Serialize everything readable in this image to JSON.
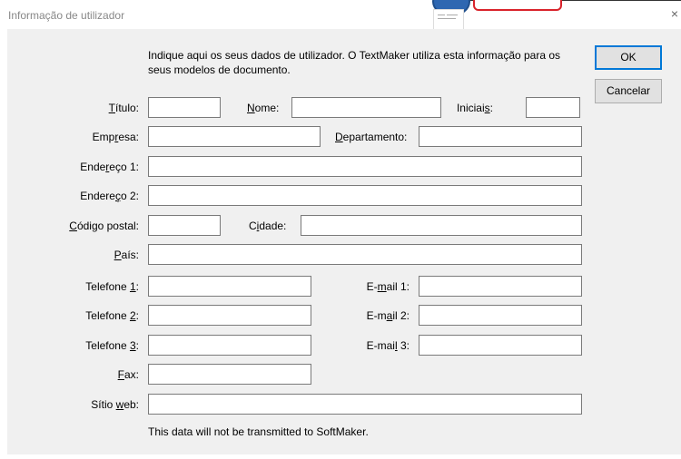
{
  "window": {
    "title": "Informação de utilizador",
    "close_glyph": "×"
  },
  "intro_text": "Indique aqui os seus dados de utilizador. O TextMaker utiliza esta informação para os seus modelos de documento.",
  "buttons": {
    "ok": "OK",
    "cancel": "Cancelar"
  },
  "labels": {
    "titulo": {
      "pre": "",
      "u": "T",
      "post": "ítulo:"
    },
    "nome": {
      "pre": "",
      "u": "N",
      "post": "ome:"
    },
    "iniciais": {
      "pre": "Iniciai",
      "u": "s",
      "post": ":"
    },
    "empresa": {
      "pre": "Emp",
      "u": "r",
      "post": "esa:"
    },
    "departamento": {
      "pre": "",
      "u": "D",
      "post": "epartamento:"
    },
    "endereco1": {
      "pre": "Ende",
      "u": "r",
      "post": "eço 1:"
    },
    "endereco2": {
      "pre": "Endere",
      "u": "ç",
      "post": "o 2:"
    },
    "codigo_postal": {
      "pre": "",
      "u": "C",
      "post": "ódigo postal:"
    },
    "cidade": {
      "pre": "C",
      "u": "i",
      "post": "dade:"
    },
    "pais": {
      "pre": "",
      "u": "P",
      "post": "aís:"
    },
    "telefone1": {
      "pre": "Telefone ",
      "u": "1",
      "post": ":"
    },
    "email1": {
      "pre": "E-",
      "u": "m",
      "post": "ail 1:"
    },
    "telefone2": {
      "pre": "Telefone ",
      "u": "2",
      "post": ":"
    },
    "email2": {
      "pre": "E-m",
      "u": "a",
      "post": "il 2:"
    },
    "telefone3": {
      "pre": "Telefone ",
      "u": "3",
      "post": ":"
    },
    "email3": {
      "pre": "E-mai",
      "u": "l",
      "post": " 3:"
    },
    "fax": {
      "pre": "",
      "u": "F",
      "post": "ax:"
    },
    "website": {
      "pre": "Sítio ",
      "u": "w",
      "post": "eb:"
    }
  },
  "fields": {
    "titulo": "",
    "nome": "",
    "iniciais": "",
    "empresa": "",
    "departamento": "",
    "endereco1": "",
    "endereco2": "",
    "codigo_postal": "",
    "cidade": "",
    "pais": "",
    "telefone1": "",
    "email1": "",
    "telefone2": "",
    "email2": "",
    "telefone3": "",
    "email3": "",
    "fax": "",
    "website": ""
  },
  "footer_note": "This data will not be transmitted to SoftMaker.",
  "colors": {
    "dialog_bg": "#f0f0f0",
    "default_button_border": "#0078d7",
    "field_border": "#7a7a7a"
  }
}
